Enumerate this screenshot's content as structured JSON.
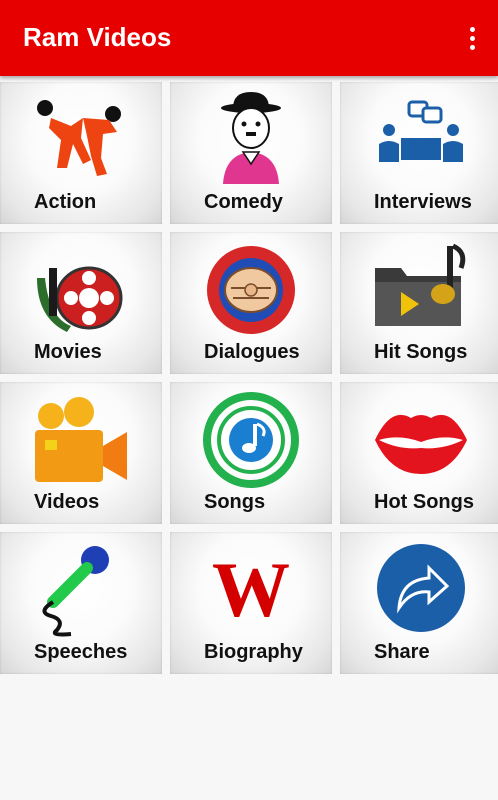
{
  "app": {
    "title": "Ram Videos"
  },
  "colors": {
    "appbar": "#e60000"
  },
  "tiles": [
    {
      "label": "Action",
      "icon": "action-fighters-icon"
    },
    {
      "label": "Comedy",
      "icon": "comedy-chaplin-icon"
    },
    {
      "label": "Interviews",
      "icon": "interview-people-icon"
    },
    {
      "label": "Movies",
      "icon": "film-reel-icon"
    },
    {
      "label": "Dialogues",
      "icon": "pointing-fist-icon"
    },
    {
      "label": "Hit Songs",
      "icon": "music-folder-icon"
    },
    {
      "label": "Videos",
      "icon": "video-camera-icon"
    },
    {
      "label": "Songs",
      "icon": "music-note-circle-icon"
    },
    {
      "label": "Hot Songs",
      "icon": "red-lips-icon"
    },
    {
      "label": "Speeches",
      "icon": "microphone-icon"
    },
    {
      "label": "Biography",
      "icon": "wikipedia-w-icon"
    },
    {
      "label": "Share",
      "icon": "share-arrow-icon"
    }
  ]
}
